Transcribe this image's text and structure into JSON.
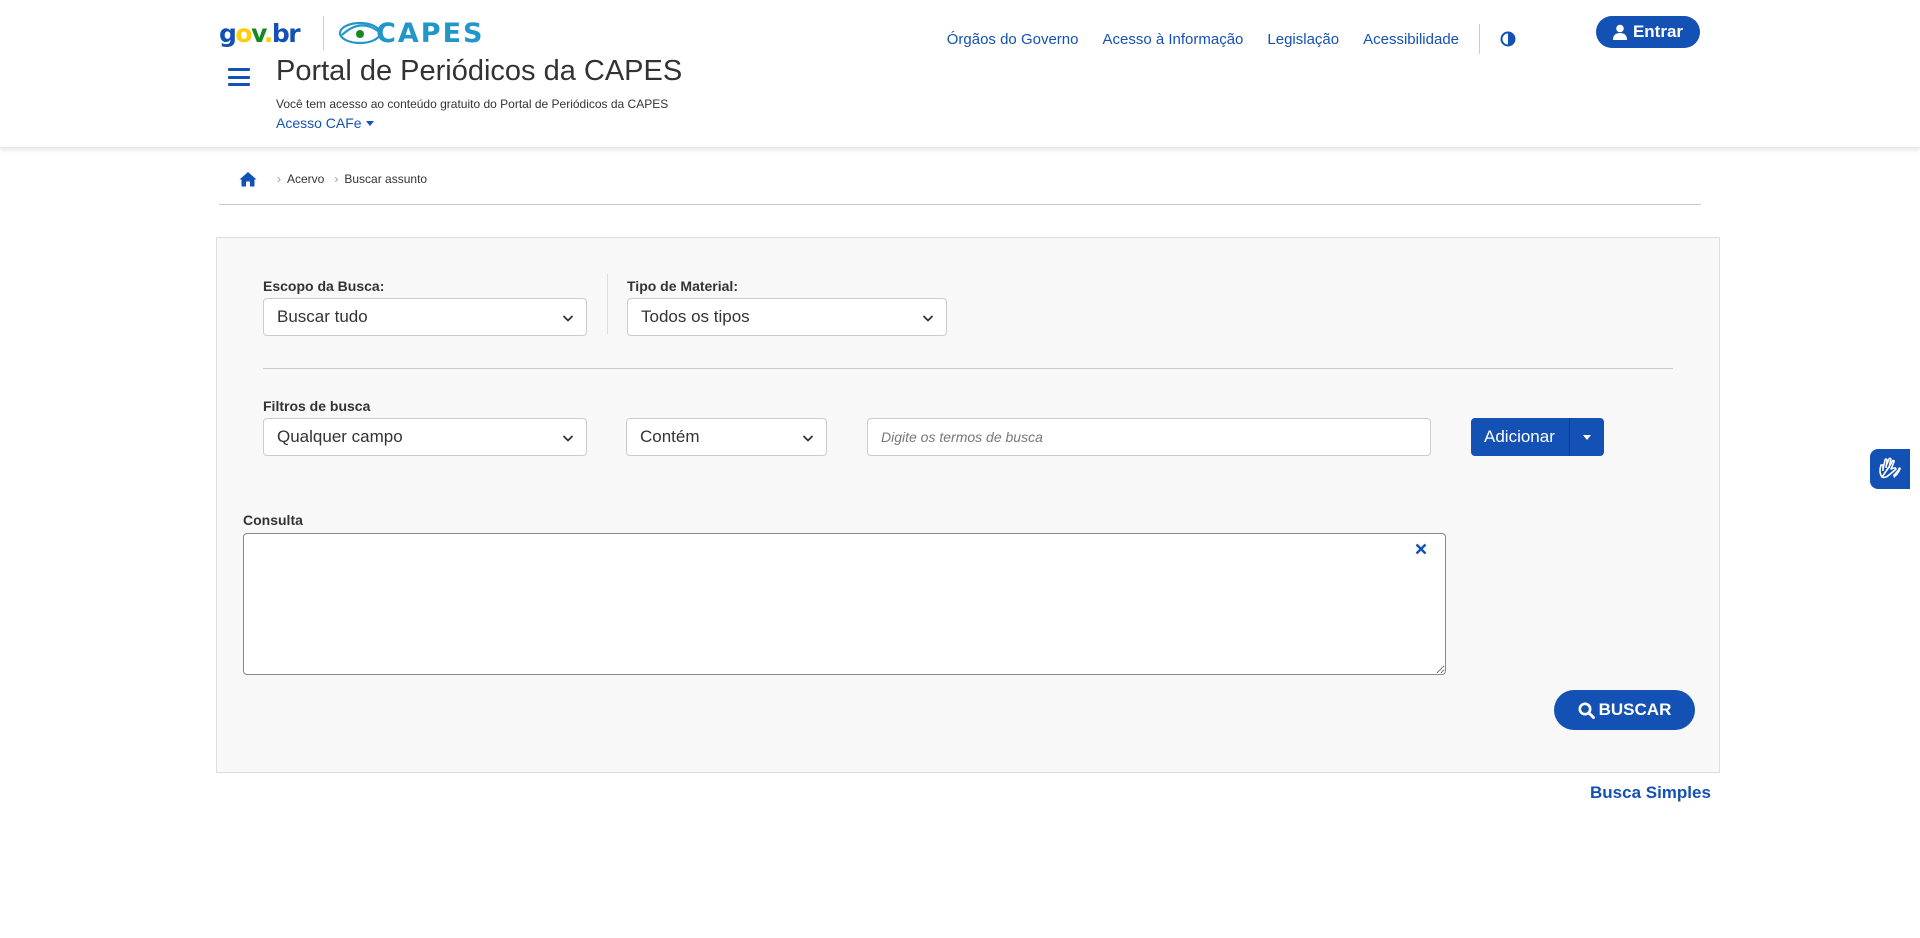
{
  "header": {
    "govbr_logo": "gov.br",
    "capes_logo": "CAPES",
    "links": [
      "Órgãos do Governo",
      "Acesso à Informação",
      "Legislação",
      "Acessibilidade"
    ],
    "login_label": "Entrar",
    "title": "Portal de Periódicos da CAPES",
    "subtitle": "Você tem acesso ao conteúdo gratuito do Portal de Periódicos da CAPES",
    "cafe_label": "Acesso CAFe"
  },
  "breadcrumb": {
    "items": [
      "Acervo",
      "Buscar assunto"
    ]
  },
  "search": {
    "scope_label": "Escopo da Busca:",
    "scope_value": "Buscar tudo",
    "material_label": "Tipo de Material:",
    "material_value": "Todos os tipos",
    "filters_label": "Filtros de busca",
    "field_value": "Qualquer campo",
    "operator_value": "Contém",
    "terms_placeholder": "Digite os termos de busca",
    "add_label": "Adicionar",
    "query_label": "Consulta",
    "search_label": "BUSCAR",
    "simple_search_label": "Busca Simples"
  },
  "colors": {
    "primary": "#1351b4",
    "capes_blue": "#2196c9",
    "panel_bg": "#f8f8f8"
  },
  "icons": {
    "menu": "hamburger-icon",
    "contrast": "contrast-icon",
    "user": "user-icon",
    "home": "home-icon",
    "chevron": "chevron-down-icon",
    "clear": "close-icon",
    "search": "search-icon",
    "accessibility": "sign-language-icon"
  }
}
